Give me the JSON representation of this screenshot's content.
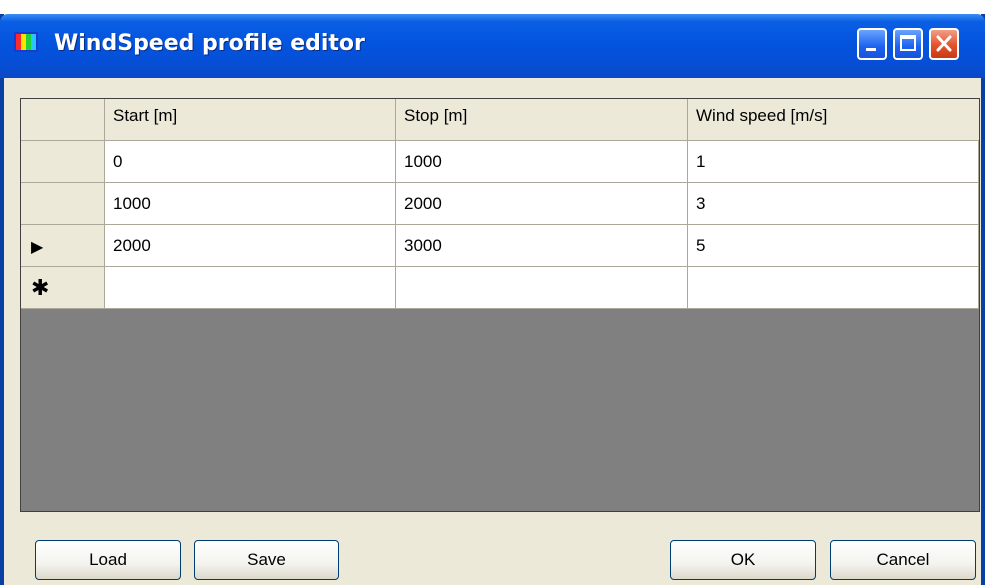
{
  "window": {
    "title": "WindSpeed profile editor",
    "icons": {
      "app": "app-icon",
      "minimize": "minimize-icon",
      "maximize": "maximize-icon",
      "close": "close-icon"
    }
  },
  "grid": {
    "columns": [
      "Start [m]",
      "Stop [m]",
      "Wind speed [m/s]"
    ],
    "rows": [
      {
        "indicator": "",
        "cells": [
          "0",
          "1000",
          "1"
        ]
      },
      {
        "indicator": "",
        "cells": [
          "1000",
          "2000",
          "3"
        ]
      },
      {
        "indicator": "current-row-arrow",
        "cells": [
          "2000",
          "3000",
          "5"
        ]
      },
      {
        "indicator": "new-row-asterisk",
        "cells": [
          "",
          "",
          ""
        ]
      }
    ]
  },
  "buttons": {
    "load": "Load",
    "save": "Save",
    "ok": "OK",
    "cancel": "Cancel"
  },
  "colors": {
    "titlebar": "#0454df",
    "dialog_bg": "#ece9d8",
    "grid_empty": "#808080"
  }
}
